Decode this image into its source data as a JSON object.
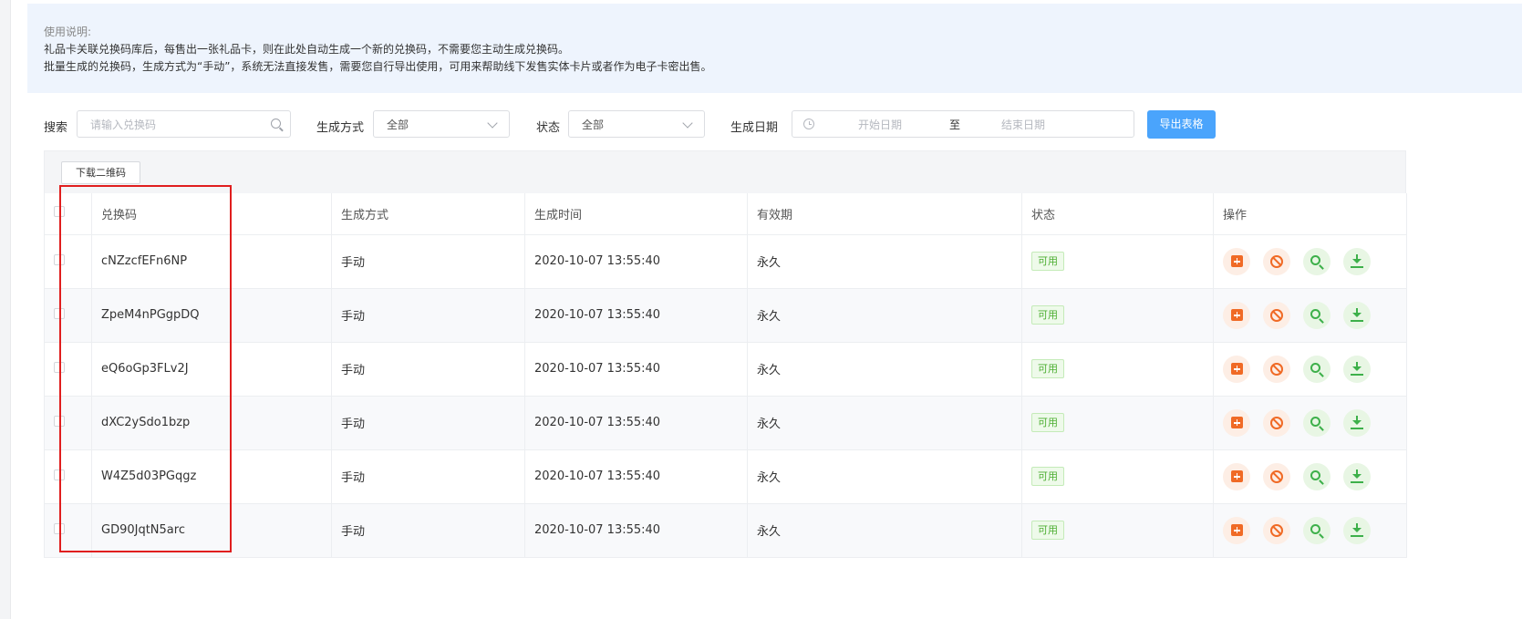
{
  "notice": {
    "title": "使用说明:",
    "lines": [
      "礼品卡关联兑换码库后，每售出一张礼品卡，则在此处自动生成一个新的兑换码，不需要您主动生成兑换码。",
      "批量生成的兑换码，生成方式为“手动”，系统无法直接发售，需要您自行导出使用，可用来帮助线下发售实体卡片或者作为电子卡密出售。"
    ]
  },
  "filters": {
    "search_label": "搜索",
    "search_placeholder": "请输入兑换码",
    "method_label": "生成方式",
    "method_value": "全部",
    "status_label": "状态",
    "status_value": "全部",
    "date_label": "生成日期",
    "date_start_placeholder": "开始日期",
    "date_separator": "至",
    "date_end_placeholder": "结束日期",
    "export_button": "导出表格"
  },
  "toolbar": {
    "download_qr_button": "下载二维码"
  },
  "table": {
    "headers": [
      "兑换码",
      "生成方式",
      "生成时间",
      "有效期",
      "状态",
      "操作"
    ],
    "rows": [
      {
        "code": "cNZzcfEFn6NP",
        "method": "手动",
        "time": "2020-10-07 13:55:40",
        "validity": "永久",
        "status": "可用"
      },
      {
        "code": "ZpeM4nPGgpDQ",
        "method": "手动",
        "time": "2020-10-07 13:55:40",
        "validity": "永久",
        "status": "可用"
      },
      {
        "code": "eQ6oGp3FLv2J",
        "method": "手动",
        "time": "2020-10-07 13:55:40",
        "validity": "永久",
        "status": "可用"
      },
      {
        "code": "dXC2ySdo1bzp",
        "method": "手动",
        "time": "2020-10-07 13:55:40",
        "validity": "永久",
        "status": "可用"
      },
      {
        "code": "W4Z5d03PGqgz",
        "method": "手动",
        "time": "2020-10-07 13:55:40",
        "validity": "永久",
        "status": "可用"
      },
      {
        "code": "GD90JqtN5arc",
        "method": "手动",
        "time": "2020-10-07 13:55:40",
        "validity": "永久",
        "status": "可用"
      }
    ]
  },
  "colors": {
    "accent": "#4aa4fc",
    "highlight": "#e01e1e",
    "status_green": "#4cae31",
    "action_orange": "#f06a25"
  },
  "action_icons": [
    "copy-add-icon",
    "disable-icon",
    "view-icon",
    "download-icon"
  ]
}
